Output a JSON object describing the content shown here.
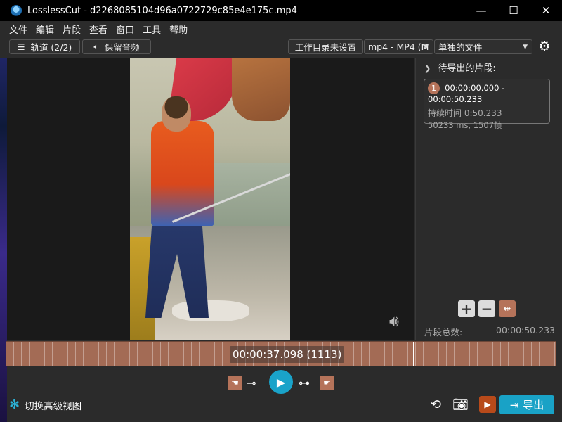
{
  "window": {
    "title": "LosslessCut - d2268085104d96a0722729c85e4e175c.mp4",
    "minimize": "—",
    "maximize": "☐",
    "close": "✕"
  },
  "menu": [
    "文件",
    "编辑",
    "片段",
    "查看",
    "窗口",
    "工具",
    "帮助"
  ],
  "toolbar": {
    "tracks_label": "轨道 (2/2)",
    "keep_audio_label": "保留音频",
    "workdir_label": "工作目录未设置",
    "format_select": "mp4 - MP4 (M",
    "output_mode_select": "单独的文件"
  },
  "segments_panel": {
    "header": "待导出的片段:",
    "segments": [
      {
        "index": "1",
        "time_range": "00:00:00.000 - 00:00:50.233",
        "duration_label": "持续时间 0:50.233",
        "frames_label": "50233 ms, 1507帧"
      }
    ],
    "total_label": "片段总数:",
    "total_value": "00:00:50.233"
  },
  "timeline": {
    "current_time": "00:00:37.098 (1113)",
    "cursor_fraction": 0.7385
  },
  "bottom": {
    "advanced_view_label": "切换高级视图",
    "export_label": "导出"
  },
  "colors": {
    "accent": "#1aa3c9",
    "segment": "#b5735a",
    "timeline": "#a36b55",
    "background": "#2b2b2b"
  }
}
